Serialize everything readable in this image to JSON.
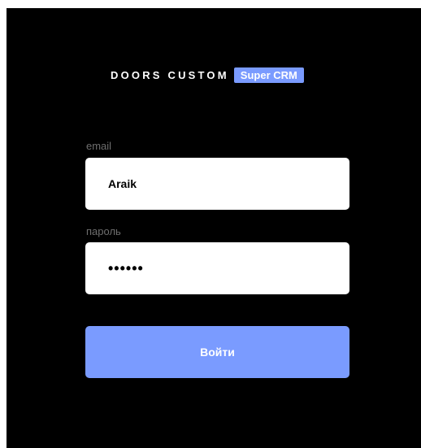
{
  "logo": {
    "text": "DOORS CUSTOM",
    "badge": "Super CRM",
    "badge_color": "#7a9bff"
  },
  "login": {
    "email_label": "email",
    "email_value": "Araik",
    "password_label": "пароль",
    "password_masked": "••••••",
    "submit_label": "Войти"
  },
  "colors": {
    "background": "#000000",
    "accent": "#7a9bff",
    "label": "#6e6e6e"
  }
}
